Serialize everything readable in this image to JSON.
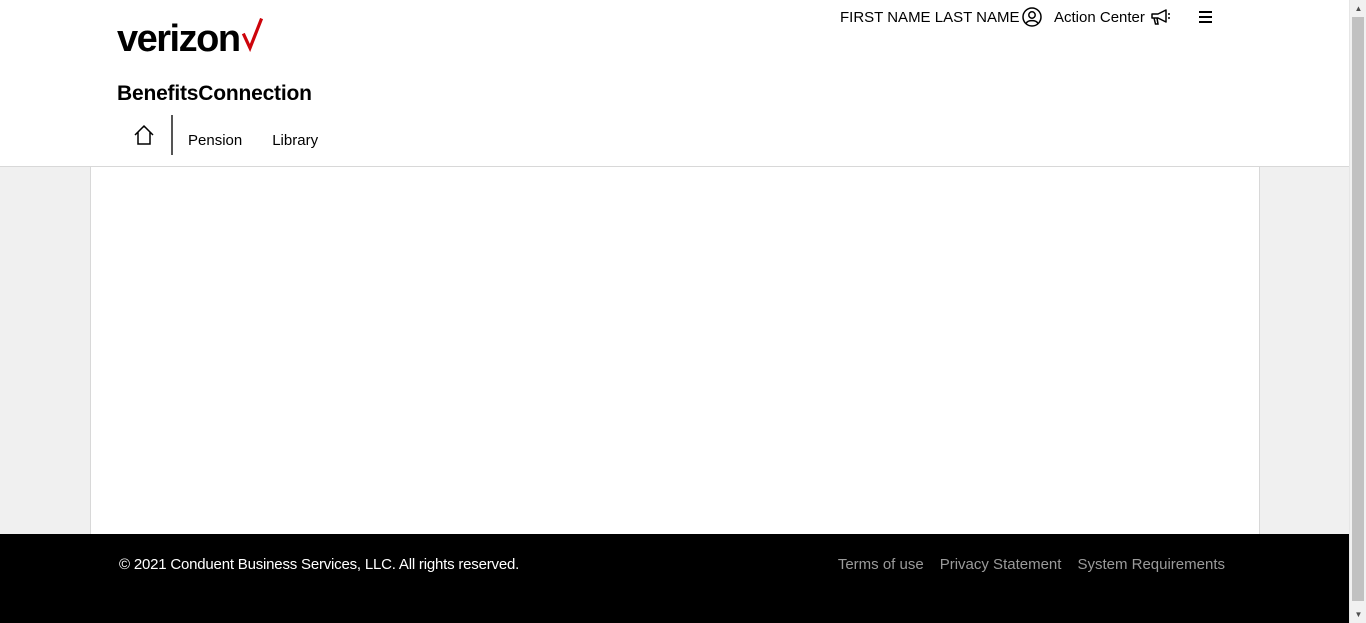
{
  "brand": {
    "logo_text": "verizon",
    "accent_color": "#cd040b"
  },
  "site_title": "BenefitsConnection",
  "nav": {
    "home_icon": "home-icon",
    "items": [
      {
        "label": "Pension"
      },
      {
        "label": "Library"
      }
    ]
  },
  "header_right": {
    "user_name": "FIRST NAME LAST NAME",
    "user_icon": "user-circle-icon",
    "action_center": "Action Center",
    "action_icon": "megaphone-icon",
    "menu_icon": "hamburger-menu-icon"
  },
  "footer": {
    "copyright": "© 2021 Conduent Business Services, LLC. All rights reserved.",
    "links": [
      {
        "label": "Terms of use"
      },
      {
        "label": "Privacy Statement"
      },
      {
        "label": "System Requirements"
      }
    ]
  }
}
